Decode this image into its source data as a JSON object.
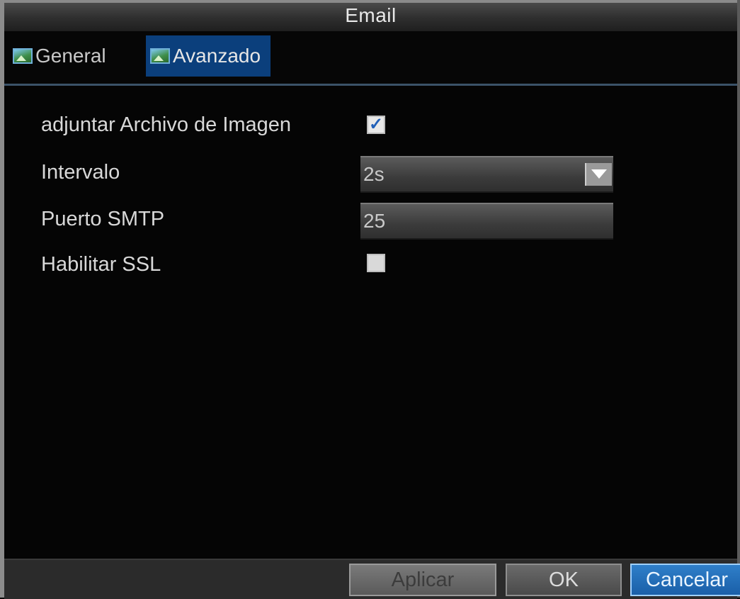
{
  "window": {
    "title": "Email"
  },
  "tabs": [
    {
      "label": "General",
      "active": false
    },
    {
      "label": "Avanzado",
      "active": true
    }
  ],
  "form": {
    "attach_image": {
      "label": "adjuntar Archivo de Imagen",
      "checked": true
    },
    "interval": {
      "label": "Intervalo",
      "value": "2s"
    },
    "smtp_port": {
      "label": "Puerto SMTP",
      "value": "25"
    },
    "ssl": {
      "label": "Habilitar SSL",
      "checked": false
    }
  },
  "buttons": {
    "apply": "Aplicar",
    "ok": "OK",
    "cancel": "Cancelar"
  },
  "colors": {
    "active_tab": "#0b3f7c",
    "cancel_button": "#1a5fa8"
  },
  "icons": {
    "tab": "image-icon",
    "checkbox_checked": "checkmark-icon",
    "dropdown": "chevron-down-icon"
  }
}
